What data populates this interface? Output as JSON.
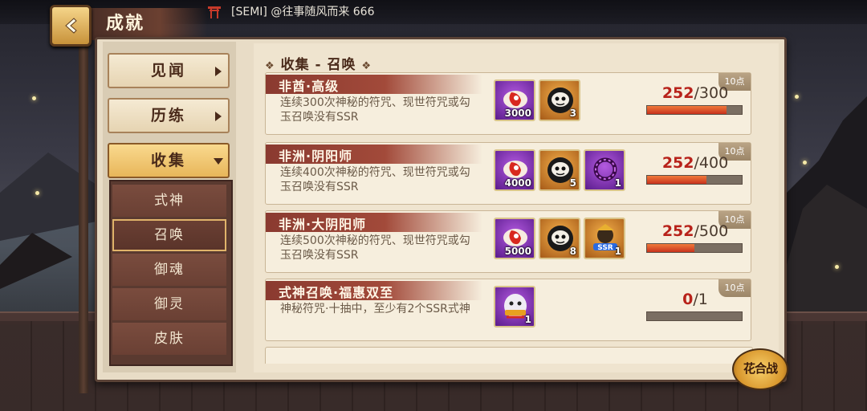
{
  "header": {
    "title": "成就",
    "chat_message": "[SEMI] @往事随风而来 666"
  },
  "sidebar": {
    "categories": [
      {
        "label": "见闻"
      },
      {
        "label": "历练"
      },
      {
        "label": "收集"
      }
    ],
    "subitems": [
      {
        "label": "式神"
      },
      {
        "label": "召唤"
      },
      {
        "label": "御魂"
      },
      {
        "label": "御灵"
      },
      {
        "label": "皮肤"
      }
    ]
  },
  "main": {
    "section_title": "收集 - 召唤",
    "achievements": [
      {
        "title": "非酋·高级",
        "description": "连续300次神秘的符咒、现世符咒或勾玉召唤没有SSR",
        "points": "10点",
        "current": "252",
        "total": "/300",
        "progress": 0.84,
        "rewards": [
          {
            "icon": "amulet-icon",
            "count": "3000"
          },
          {
            "icon": "daruma-icon",
            "count": "3"
          }
        ]
      },
      {
        "title": "非洲·阴阳师",
        "description": "连续400次神秘的符咒、现世符咒或勾玉召唤没有SSR",
        "points": "10点",
        "current": "252",
        "total": "/400",
        "progress": 0.63,
        "rewards": [
          {
            "icon": "amulet-icon",
            "count": "4000"
          },
          {
            "icon": "daruma-icon",
            "count": "5"
          },
          {
            "icon": "ring-icon",
            "count": "1"
          }
        ]
      },
      {
        "title": "非洲·大阴阳师",
        "description": "连续500次神秘的符咒、现世符咒或勾玉召唤没有SSR",
        "points": "10点",
        "current": "252",
        "total": "/500",
        "progress": 0.504,
        "rewards": [
          {
            "icon": "amulet-icon",
            "count": "5000"
          },
          {
            "icon": "daruma-icon",
            "count": "8"
          },
          {
            "icon": "ssr-avatar-icon",
            "count": "1"
          }
        ]
      },
      {
        "title": "式神召唤·福惠双至",
        "description": "神秘符咒·十抽中，至少有2个SSR式神",
        "points": "10点",
        "current": "0",
        "total": "/1",
        "progress": 0.0,
        "rewards": [
          {
            "icon": "material-daruma-icon",
            "count": "1"
          }
        ]
      }
    ]
  },
  "corner_button": {
    "label": "花合战"
  }
}
